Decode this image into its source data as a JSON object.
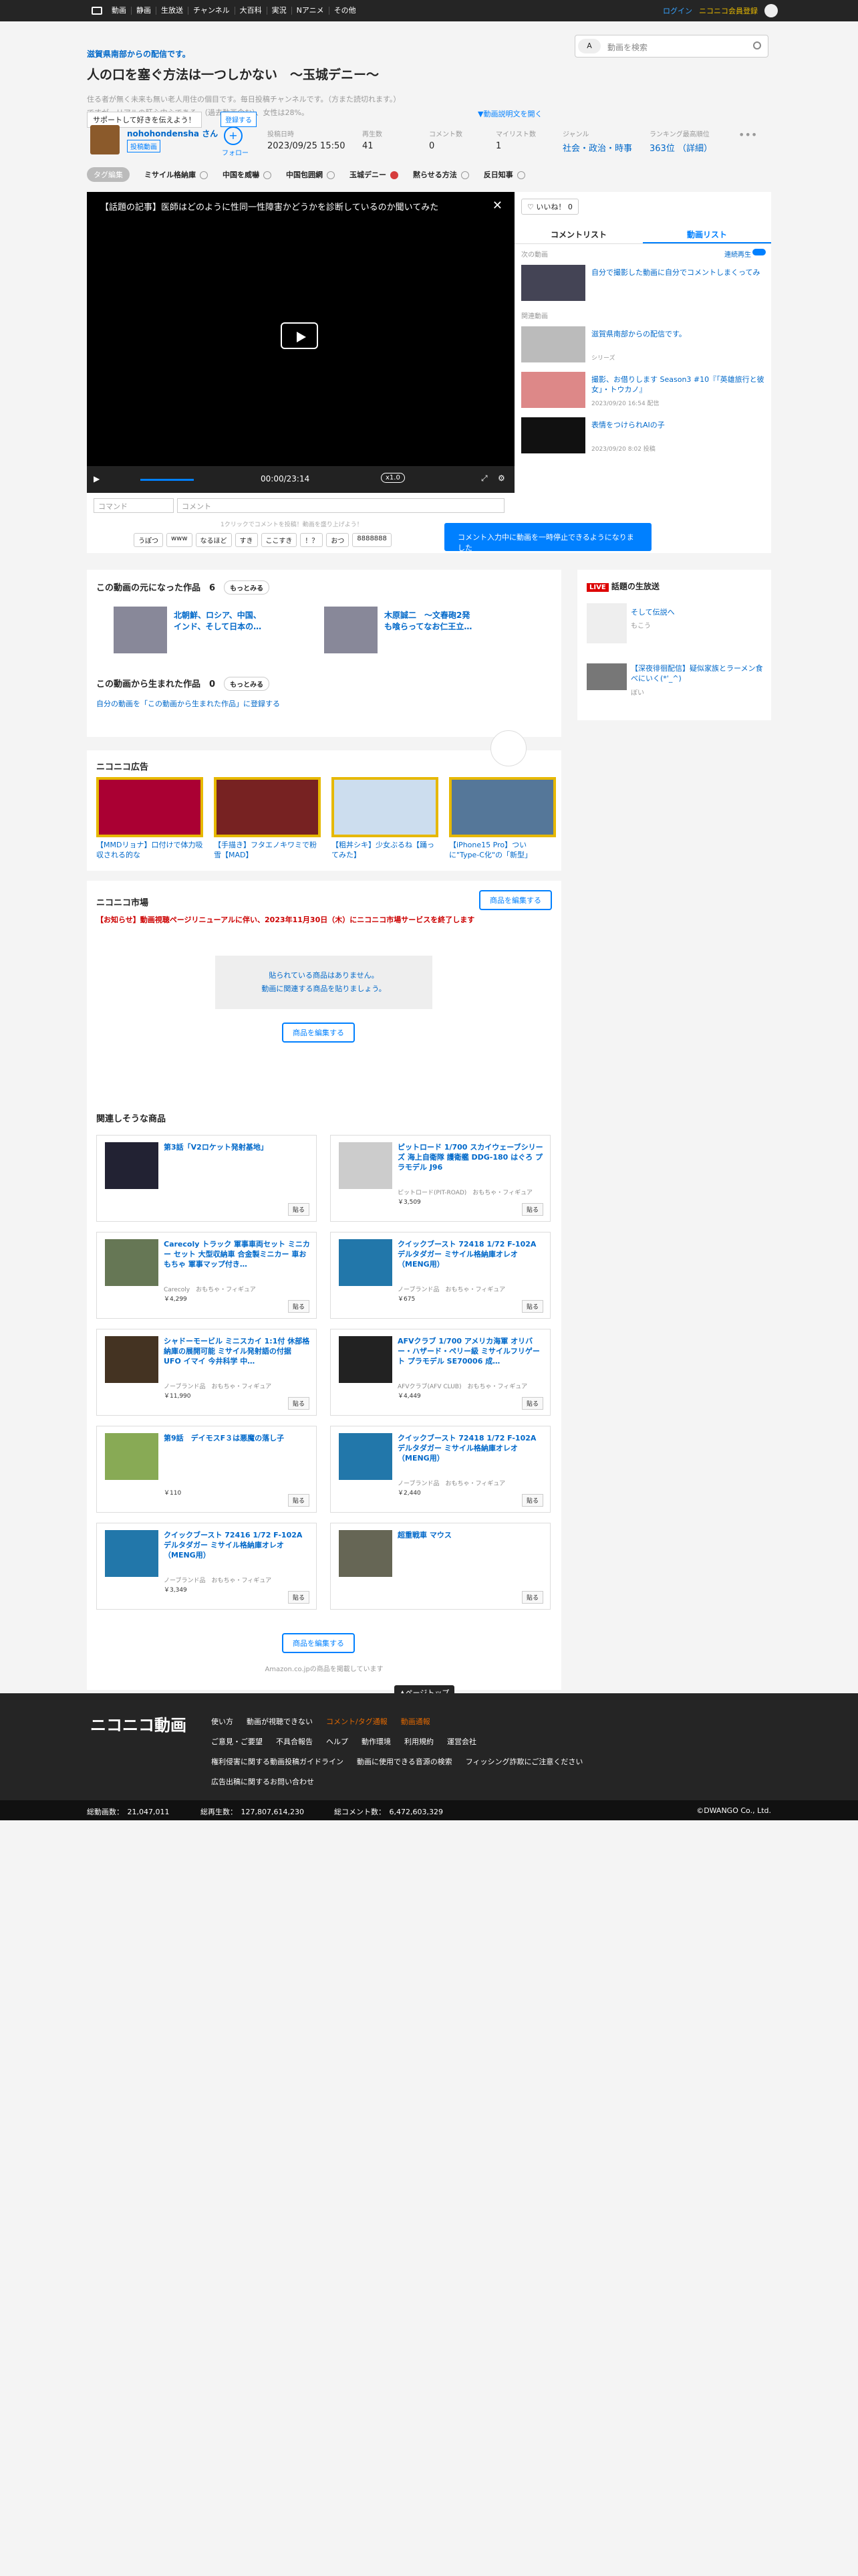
{
  "topbar": {
    "nav": [
      "動画",
      "静画",
      "生放送",
      "チャンネル",
      "大百科",
      "実況",
      "Nアニメ",
      "その他"
    ],
    "login": "ログイン",
    "premium": "ニコニコ会員登録"
  },
  "header": {
    "owner": "滋賀県南部からの配信です。",
    "title": "人の口を塞ぐ方法は一つしかない　～玉城デニー～",
    "desc_1": "住る者が無く未来も無い老人用住の個目です。毎日投稿チャンネルです。（方また読切れます。）",
    "desc_2": "ですが、リアルの肝心中心である。（過去動画含む）、女性は28%。",
    "support": "サポートして好きを伝えよう！",
    "register": "登録する",
    "expand": "▼動画説明文を開く"
  },
  "search": {
    "selector": "A",
    "placeholder": "動画を検索"
  },
  "meta": {
    "uploader": "nohohondensha さん",
    "uploader_badge": "投稿動画",
    "follow": "フォロー",
    "posted_label": "投稿日時",
    "posted": "2023/09/25 15:50",
    "views_label": "再生数",
    "views": "41",
    "comments_label": "コメント数",
    "comments": "0",
    "mylist_label": "マイリスト数",
    "mylist": "1",
    "genre_label": "ジャンル",
    "genre": "社会・政治・時事",
    "rank_label": "ランキング最高順位",
    "rank": "363位 （詳細）"
  },
  "tags": {
    "edit": "タグ編集",
    "items": [
      "ミサイル格納庫",
      "中国を威嚇",
      "中国包囲網",
      "玉城デニー",
      "黙らせる方法",
      "反日知事"
    ]
  },
  "player": {
    "video_title": "【話題の記事】医師はどのように性同一性障害かどうかを診断しているのか聞いてみた",
    "time": "00:00/23:14",
    "speed": "x1.0"
  },
  "comment": {
    "command_ph": "コマンド",
    "comment_ph": "コメント",
    "hint": "1クリックでコメントを投稿！動画を盛り上げよう！",
    "chips": [
      "うぽつ",
      "www",
      "なるほど",
      "すき",
      "ここすき",
      "！？",
      "おつ",
      "8888888"
    ],
    "tooltip": "コメント入力中に動画を一時停止できるようになりました"
  },
  "panel": {
    "like": "いいね！",
    "like_count": "0",
    "tab_comments": "コメントリスト",
    "tab_videos": "動画リスト",
    "next_label": "次の動画",
    "autoplay": "連続再生",
    "next_title": "自分で撮影した動画に自分でコメントしまくってみ",
    "related_label": "関連動画",
    "items": [
      {
        "title": "滋賀県南部からの配信です。",
        "stat": "シリーズ"
      },
      {
        "title": "撮影、お借りします Season3 #10『「英雄旅行と彼女」・トウカノ』",
        "stat": "2023/09/20 16:54 配信"
      },
      {
        "title": "表情をつけられAIの子",
        "stat": "2023/09/20 8:02 投稿"
      }
    ]
  },
  "origin": {
    "title": "この動画の元になった作品",
    "count": "6",
    "more": "もっとみる",
    "items": [
      "北朝鮮、ロシア、中国、インド、そして日本の…",
      "木原誠二　～文春砲2発も喰らってなお仁王立…"
    ]
  },
  "born": {
    "title": "この動画から生まれた作品",
    "count": "0",
    "more": "もっとみる",
    "register": "自分の動画を「この動画から生まれた作品」に登録する"
  },
  "ads": {
    "title": "ニコニコ広告",
    "items": [
      "【MMDリョナ】口付けで体力吸収される的な",
      "【手描き】フタエノキワミで粉雪【MAD】",
      "【粗丼シキ】少女ぶるね【踊ってみた】",
      "【iPhone15 Pro】ついに\"Type-C化\"の「新型」"
    ]
  },
  "market": {
    "title": "ニコニコ市場",
    "edit": "商品を編集する",
    "notice": "【お知らせ】動画視聴ページリニューアルに伴い、2023年11月30日（木）にニコニコ市場サービスを終了します",
    "empty_1": "貼られている商品はありません。",
    "empty_2": "動画に関連する商品を貼りましょう。",
    "related_title": "関連しそうな商品",
    "footer_note": "Amazon.co.jpの商品を掲載しています",
    "paste": "貼る",
    "products": [
      {
        "title": "第3話「V2ロケット発射基地」",
        "maker": "",
        "price": ""
      },
      {
        "title": "ピットロード 1/700 スカイウェーブシリーズ 海上自衛隊 護衛艦 DDG-180 はぐろ プラモデル J96",
        "maker": "ピットロード(PIT-ROAD)　おもちゃ・フィギュア",
        "price": "￥3,509"
      },
      {
        "title": "Carecoly トラック 軍事車両セット ミニカー セット 大型収納車 合金製ミニカー 車おもちゃ 軍事マップ付き…",
        "maker": "Carecoly　おもちゃ・フィギュア",
        "price": "￥4,299"
      },
      {
        "title": "クイックブースト 72418 1/72 F-102A デルタダガー ミサイル格納庫オレオ（MENG用）",
        "maker": "ノーブランド品　おもちゃ・フィギュア",
        "price": "￥675"
      },
      {
        "title": "シャドーモービル ミニスカイ 1:1付 休部格納庫の展開可能 ミサイル発射語の付据 UFO イマイ 今井科学 中…",
        "maker": "ノーブランド品　おもちゃ・フィギュア",
        "price": "￥11,990"
      },
      {
        "title": "AFVクラブ 1/700 アメリカ海軍 オリバー・ハザード・ペリー級 ミサイルフリゲート プラモデル SE70006 成…",
        "maker": "AFVクラブ(AFV CLUB)　おもちゃ・フィギュア",
        "price": "￥4,449"
      },
      {
        "title": "第9話　デイモスF３は悪魔の落し子",
        "maker": "",
        "price": "￥110"
      },
      {
        "title": "クイックブースト 72418 1/72 F-102A デルタダガー ミサイル格納庫オレオ（MENG用）",
        "maker": "ノーブランド品　おもちゃ・フィギュア",
        "price": "￥2,440"
      },
      {
        "title": "クイックブースト 72416 1/72 F-102A デルタダガー ミサイル格納庫オレオ（MENG用）",
        "maker": "ノーブランド品　おもちゃ・フィギュア",
        "price": "￥3,349"
      },
      {
        "title": "超重戦車 マウス",
        "maker": "",
        "price": ""
      }
    ]
  },
  "live": {
    "badge": "LIVE",
    "title": "話題の生放送",
    "items": [
      {
        "title": "そして伝説へ",
        "sub": "もこう"
      },
      {
        "title": "【深夜徘徊配信】疑似家族とラーメン食べにいく(*'_^)",
        "sub": "ぼい"
      }
    ]
  },
  "footer": {
    "logo": "ニコニコ動画",
    "pagetop": "▲ページトップ",
    "links": [
      "使い方",
      "動画が視聴できない",
      "コメント/タグ通報",
      "動画通報",
      "ご意見・ご要望",
      "不具合報告",
      "ヘルプ",
      "動作環境",
      "利用規約",
      "運営会社",
      "権利侵害に関する動画投稿ガイドライン",
      "動画に使用できる音源の検索",
      "フィッシング詐欺にご注意ください",
      "広告出稿に関するお問い合わせ"
    ],
    "total_videos": "総動画数：　21,047,011",
    "total_views": "総再生数：　127,807,614,230",
    "total_comments": "総コメント数：　6,472,603,329",
    "copyright": "©DWANGO Co., Ltd."
  }
}
